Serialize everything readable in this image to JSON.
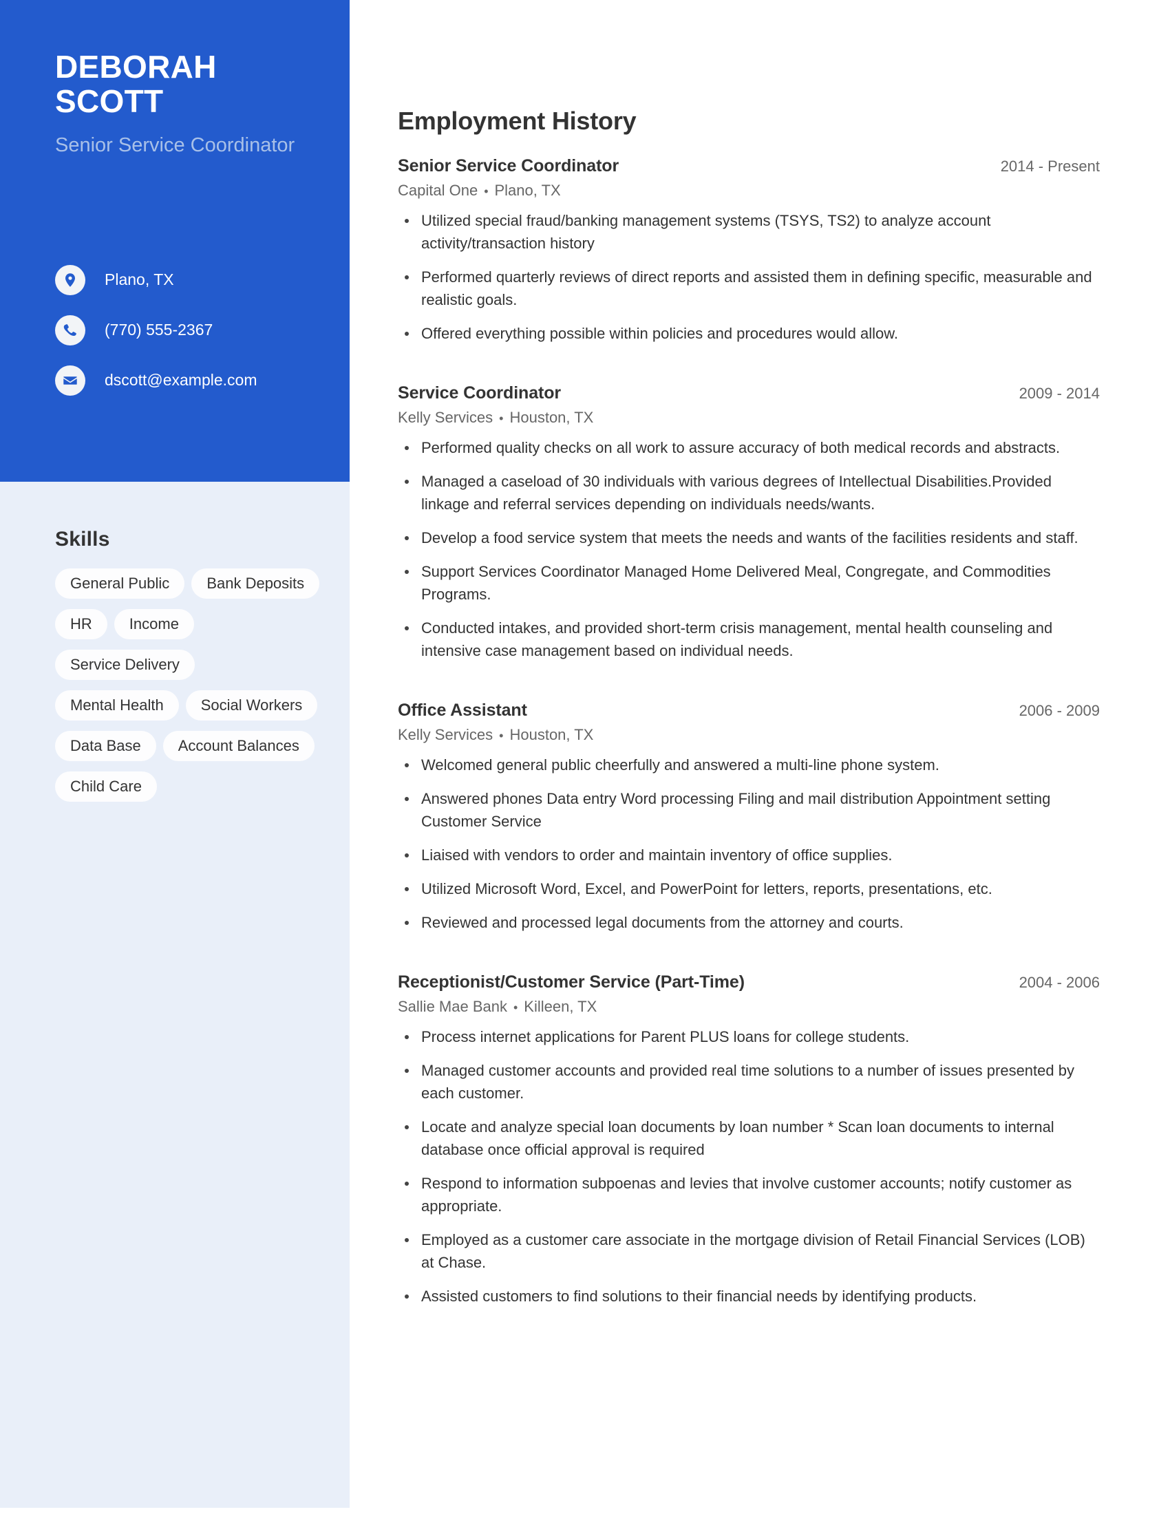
{
  "theme": {
    "accent": "#235bcd",
    "sidebar_bg": "#e9eff9",
    "pill_bg": "#fdfdfe",
    "text": "#333333",
    "muted": "#666666",
    "subtitle": "#a8c0e8"
  },
  "profile": {
    "first_name": "DEBORAH",
    "last_name": "SCOTT",
    "headline": "Senior Service Coordinator",
    "contacts": [
      {
        "icon": "location-pin-icon",
        "value": "Plano, TX"
      },
      {
        "icon": "phone-icon",
        "value": "(770) 555-2367"
      },
      {
        "icon": "email-icon",
        "value": "dscott@example.com"
      }
    ]
  },
  "skills": {
    "title": "Skills",
    "items": [
      "General Public",
      "Bank Deposits",
      "HR",
      "Income",
      "Service Delivery",
      "Mental Health",
      "Social Workers",
      "Data Base",
      "Account Balances",
      "Child Care"
    ]
  },
  "employment": {
    "title": "Employment History",
    "jobs": [
      {
        "role": "Senior Service Coordinator",
        "dates": "2014 - Present",
        "company": "Capital One",
        "location": "Plano, TX",
        "separator": "•",
        "bullets": [
          "Utilized special fraud/banking management systems (TSYS, TS2) to analyze account activity/transaction history",
          "Performed quarterly reviews of direct reports and assisted them in defining specific, measurable and realistic goals.",
          "Offered everything possible within policies and procedures would allow."
        ]
      },
      {
        "role": "Service Coordinator",
        "dates": "2009 - 2014",
        "company": "Kelly Services",
        "location": "Houston, TX",
        "separator": "•",
        "bullets": [
          "Performed quality checks on all work to assure accuracy of both medical records and abstracts.",
          "Managed a caseload of 30 individuals with various degrees of Intellectual Disabilities.Provided linkage and referral services depending on individuals needs/wants.",
          "Develop a food service system that meets the needs and wants of the facilities residents and staff.",
          "Support Services Coordinator Managed Home Delivered Meal, Congregate, and Commodities Programs.",
          "Conducted intakes, and provided short-term crisis management, mental health counseling and intensive case management based on individual needs."
        ]
      },
      {
        "role": "Office Assistant",
        "dates": "2006 - 2009",
        "company": "Kelly Services",
        "location": "Houston, TX",
        "separator": "•",
        "bullets": [
          "Welcomed general public cheerfully and answered a multi-line phone system.",
          "Answered phones Data entry Word processing Filing and mail distribution Appointment setting Customer Service",
          "Liaised with vendors to order and maintain inventory of office supplies.",
          "Utilized Microsoft Word, Excel, and PowerPoint for letters, reports, presentations, etc.",
          "Reviewed and processed legal documents from the attorney and courts."
        ]
      },
      {
        "role": "Receptionist/Customer Service (Part-Time)",
        "dates": "2004 - 2006",
        "company": "Sallie Mae Bank",
        "location": "Killeen, TX",
        "separator": "•",
        "bullets": [
          "Process internet applications for Parent PLUS loans for college students.",
          "Managed customer accounts and provided real time solutions to a number of issues presented by each customer.",
          "Locate and analyze special loan documents by loan number * Scan loan documents to internal database once official approval is required",
          "Respond to information subpoenas and levies that involve customer accounts; notify customer as appropriate.",
          "Employed as a customer care associate in the mortgage division of Retail Financial Services (LOB) at Chase.",
          "Assisted customers to find solutions to their financial needs by identifying products."
        ]
      }
    ]
  }
}
